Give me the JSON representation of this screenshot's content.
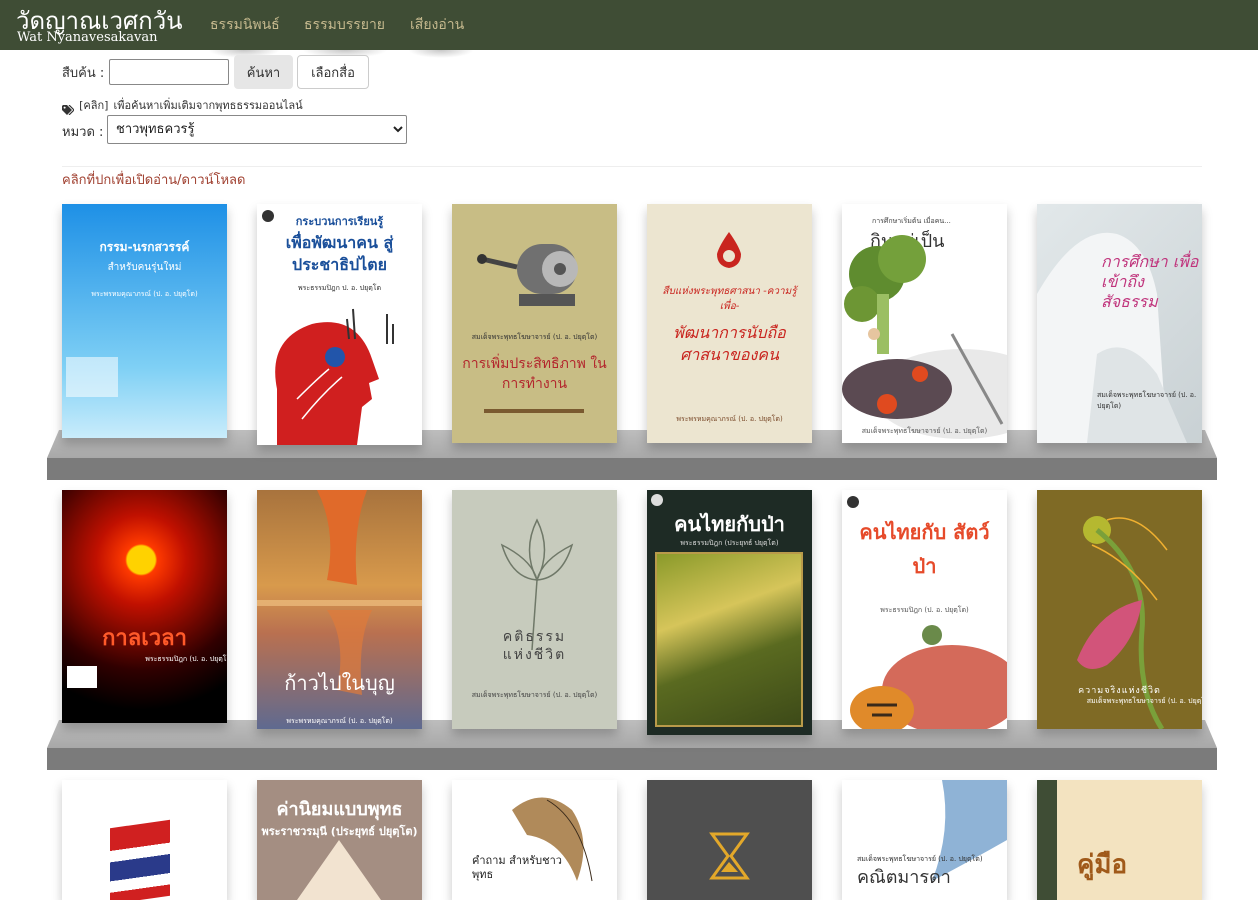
{
  "site": {
    "title_th": "วัดญาณเวศกวัน",
    "title_en": "Wat Nyanavesakavan"
  },
  "nav": {
    "items": [
      {
        "label": "ธรรมนิพนธ์"
      },
      {
        "label": "ธรรมบรรยาย"
      },
      {
        "label": "เสียงอ่าน"
      }
    ]
  },
  "search": {
    "label": "สืบค้น :",
    "value": "",
    "search_button": "ค้นหา",
    "choose_book_button": "เลือกสื่อ"
  },
  "hint": {
    "link": "[คลิก]",
    "text": "เพื่อค้นหาเพิ่มเติมจากพุทธธรรมออนไลน์"
  },
  "category": {
    "label": "หมวด :",
    "selected": "ชาวพุทธควรรู้"
  },
  "open_hint": "คลิกที่ปกเพื่อเปิดอ่าน/ดาวน์โหลด",
  "books": [
    {
      "title": "กรรม-นรกสวรรค์",
      "subtitle": "สำหรับคนรุ่นใหม่",
      "author": "พระพรหมคุณาภรณ์ (ป. อ. ปยุตฺโต)"
    },
    {
      "title": "เพื่อพัฒนาคน สู่ประชาธิปไตย",
      "subtitle": "กระบวนการเรียนรู้",
      "author": "พระธรรมปิฎก ป. อ. ปยุตฺโต"
    },
    {
      "title": "การเพิ่มประสิทธิภาพ ในการทำงาน",
      "subtitle": "",
      "author": "สมเด็จพระพุทธโฆษาจารย์ (ป. อ. ปยุตฺโต)"
    },
    {
      "title": "พัฒนาการนับถือศาสนาของคน",
      "subtitle": "สืบแห่งพระพุทธศาสนา -ความรู้เพื่อ-",
      "author": "พระพรหมคุณาภรณ์ (ป. อ. ปยุตฺโต)"
    },
    {
      "title": "กินอยู่เป็น",
      "subtitle": "การศึกษาเริ่มต้น เมื่อคน...",
      "author": "สมเด็จพระพุทธโฆษาจารย์ (ป. อ. ปยุตฺโต)"
    },
    {
      "title": "การศึกษา เพื่อเข้าถึง สัจธรรม",
      "subtitle": "",
      "author": "สมเด็จพระพุทธโฆษาจารย์ (ป. อ. ปยุตฺโต)"
    },
    {
      "title": "กาลเวลา",
      "subtitle": "",
      "author": "พระธรรมปิฎก (ป. อ. ปยุตฺโต)"
    },
    {
      "title": "ก้าวไปในบุญ",
      "subtitle": "",
      "author": "พระพรหมคุณาภรณ์ (ป. อ. ปยุตฺโต)"
    },
    {
      "title": "คติธรรม แห่งชีวิต",
      "subtitle": "",
      "author": "สมเด็จพระพุทธโฆษาจารย์ (ป. อ. ปยุตฺโต)"
    },
    {
      "title": "คนไทยกับป่า",
      "subtitle": "",
      "author": "พระธรรมปิฎก (ประยุทธ์ ปยุตฺโต)"
    },
    {
      "title": "คนไทยกับ สัตว์ป่า",
      "subtitle": "",
      "author": "พระธรรมปิฎก (ป. อ. ปยุตฺโต)"
    },
    {
      "title": "ความจริงแห่งชีวิต",
      "subtitle": "",
      "author": "สมเด็จพระพุทธโฆษาจารย์ (ป. อ. ปยุตฺโต)"
    },
    {
      "title": "",
      "subtitle": "",
      "author": ""
    },
    {
      "title": "ค่านิยมแบบพุทธ",
      "subtitle": "",
      "author": "พระราชวรมุนี (ประยุทธ์ ปยุตฺโต)"
    },
    {
      "title": "คำถาม สำหรับชาวพุทธ",
      "subtitle": "",
      "author": ""
    },
    {
      "title": "",
      "subtitle": "",
      "author": ""
    },
    {
      "title": "คณิตมารดา",
      "subtitle": "",
      "author": "สมเด็จพระพุทธโฆษาจารย์ (ป. อ. ปยุตฺโต)"
    },
    {
      "title": "คู่มือ",
      "subtitle": "",
      "author": ""
    }
  ],
  "colors": {
    "navbar": "#3f4d35",
    "nav_link": "#c5b98e",
    "shelf_front": "#7b7b7b",
    "open_hint": "#a04030"
  }
}
